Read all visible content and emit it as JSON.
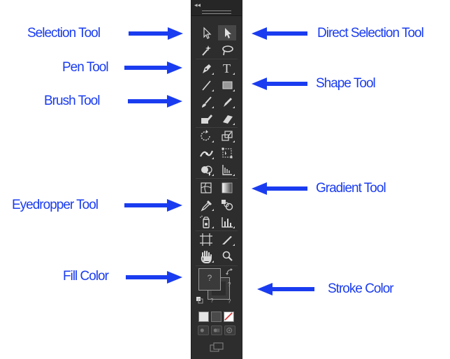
{
  "labels": {
    "selection": "Selection Tool",
    "direct_selection": "Direct Selection Tool",
    "pen": "Pen Tool",
    "shape": "Shape Tool",
    "brush": "Brush Tool",
    "gradient": "Gradient Tool",
    "eyedropper": "Eyedropper Tool",
    "fill": "Fill Color",
    "stroke": "Stroke Color"
  },
  "toolbar": {
    "collapse_glyph": "◂◂",
    "type_glyph": "T",
    "fill_placeholder": "?",
    "stroke_placeholder_a": "?",
    "stroke_placeholder_b": "?",
    "default_glyph": "?"
  },
  "colors": {
    "annotation": "#1a3cf0",
    "panel": "#2d2d2d",
    "none_slash": "#d63a3a"
  }
}
